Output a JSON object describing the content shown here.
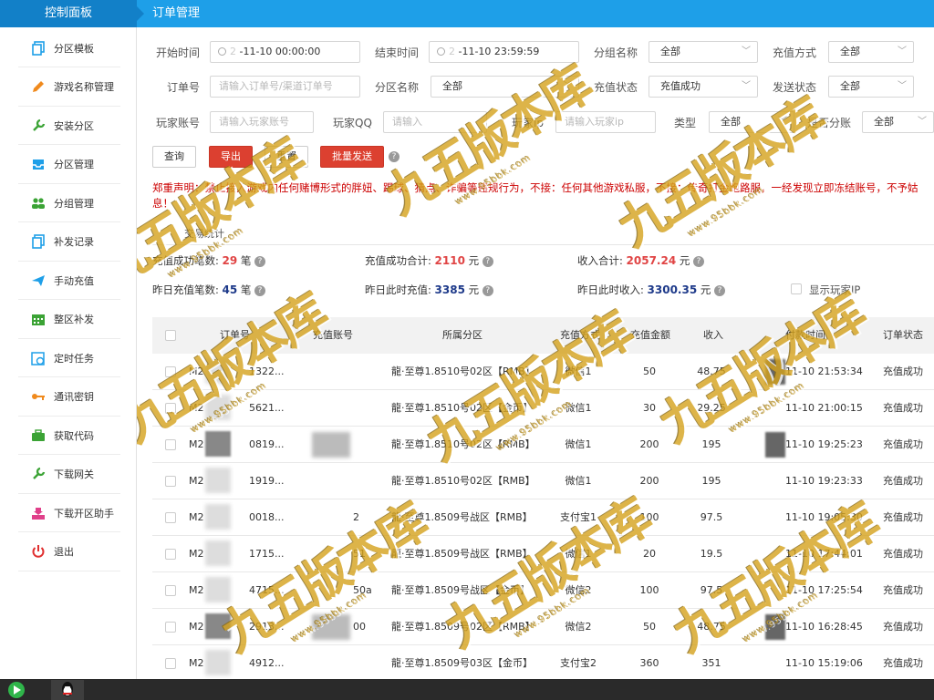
{
  "header": {
    "brand": "控制面板",
    "page_title": "订单管理"
  },
  "sidebar": {
    "items": [
      {
        "label": "分区模板",
        "icon": "copy-icon",
        "color": "#1e9fe8"
      },
      {
        "label": "游戏名称管理",
        "icon": "pencil-icon",
        "color": "#f08a1d"
      },
      {
        "label": "安装分区",
        "icon": "wrench-icon",
        "color": "#3ba335"
      },
      {
        "label": "分区管理",
        "icon": "inbox-icon",
        "color": "#1e9fe8"
      },
      {
        "label": "分组管理",
        "icon": "users-icon",
        "color": "#3ba335"
      },
      {
        "label": "补发记录",
        "icon": "copy-icon",
        "color": "#1e9fe8"
      },
      {
        "label": "手动充值",
        "icon": "send-icon",
        "color": "#1e9fe8"
      },
      {
        "label": "整区补发",
        "icon": "calendar-icon",
        "color": "#3ba335"
      },
      {
        "label": "定时任务",
        "icon": "calendar-clock-icon",
        "color": "#1e9fe8"
      },
      {
        "label": "通讯密钥",
        "icon": "key-icon",
        "color": "#f08a1d"
      },
      {
        "label": "获取代码",
        "icon": "briefcase-icon",
        "color": "#3ba335"
      },
      {
        "label": "下载网关",
        "icon": "wrench-icon",
        "color": "#3ba335"
      },
      {
        "label": "下载开区助手",
        "icon": "download-icon",
        "color": "#e0408a"
      },
      {
        "label": "退出",
        "icon": "power-icon",
        "color": "#e03030"
      }
    ]
  },
  "filters": {
    "start_time_label": "开始时间",
    "start_time_value": "-11-10 00:00:00",
    "end_time_label": "结束时间",
    "end_time_value": "-11-10 23:59:59",
    "group_label": "分组名称",
    "group_value": "全部",
    "pay_method_label": "充值方式",
    "pay_method_value": "全部",
    "order_no_label": "订单号",
    "order_no_placeholder": "请输入订单号/渠道订单号",
    "zone_label": "分区名称",
    "zone_value": "全部",
    "pay_status_label": "充值状态",
    "pay_status_value": "充值成功",
    "send_status_label": "发送状态",
    "send_status_value": "全部",
    "player_account_label": "玩家账号",
    "player_account_placeholder": "请输入玩家账号",
    "player_qq_label": "玩家QQ",
    "player_qq_placeholder": "请输入",
    "player_ip_label": "玩家ip",
    "player_ip_placeholder": "请输入玩家ip",
    "type_label": "类型",
    "type_value": "全部",
    "split_label": "是否分账",
    "split_value": "全部"
  },
  "actions": {
    "query": "查询",
    "export": "导出",
    "reset": "重置",
    "batch_send": "批量发送"
  },
  "notice": "郑重声明：禁止接入游戏内任何赌博形式的胖妞、踢球、猜点、诈骗等违规行为，不接：任何其他游戏私服，不接：传奇打金跑路服，一经发现立即冻结账号，不予姑息！",
  "stats": {
    "title": "交易统计",
    "success_count_label": "充值成功笔数:",
    "success_count_value": "29",
    "count_unit": "笔",
    "success_total_label": "充值成功合计:",
    "success_total_value": "2110",
    "money_unit": "元",
    "income_total_label": "收入合计:",
    "income_total_value": "2057.24",
    "yesterday_count_label": "昨日充值笔数:",
    "yesterday_count_value": "45",
    "yesterday_pay_label": "昨日此时充值:",
    "yesterday_pay_value": "3385",
    "yesterday_income_label": "昨日此时收入:",
    "yesterday_income_value": "3300.35",
    "show_ip_label": "显示玩家IP"
  },
  "table": {
    "headers": [
      "订单号",
      "充值账号",
      "所属分区",
      "充值方式",
      "充值金额",
      "收入",
      "付款时间",
      "订单状态"
    ],
    "rows": [
      {
        "order": "M2",
        "order_tail": "1322...",
        "account": "",
        "zone": "龍·至尊1.8510号02区【RMB】",
        "method": "微信1",
        "amount": "50",
        "income": "48.75",
        "time": "11-10 21:53:34",
        "status": "充值成功"
      },
      {
        "order": "M2",
        "order_tail": "5621...",
        "account": "",
        "zone": "龍·至尊1.8510号02区【金币】",
        "method": "微信1",
        "amount": "30",
        "income": "29.25",
        "time": "11-10 21:00:15",
        "status": "充值成功"
      },
      {
        "order": "M2",
        "order_tail": "0819...",
        "account": "",
        "zone": "龍·至尊1.8510号02区【RMB】",
        "method": "微信1",
        "amount": "200",
        "income": "195",
        "time": "11-10 19:25:23",
        "status": "充值成功"
      },
      {
        "order": "M2",
        "order_tail": "1919...",
        "account": "",
        "zone": "龍·至尊1.8510号02区【RMB】",
        "method": "微信1",
        "amount": "200",
        "income": "195",
        "time": "11-10 19:23:33",
        "status": "充值成功"
      },
      {
        "order": "M2",
        "order_tail": "0018...",
        "account": "2",
        "zone": "龍·至尊1.8509号战区【RMB】",
        "method": "支付宝1",
        "amount": "100",
        "income": "97.5",
        "time": "11-10 19:05:30",
        "status": "充值成功"
      },
      {
        "order": "M2",
        "order_tail": "1715...",
        "account": "51",
        "zone": "龍·至尊1.8509号战区【RMB】",
        "method": "微信1",
        "amount": "20",
        "income": "19.5",
        "time": "11-10 17:44:01",
        "status": "充值成功"
      },
      {
        "order": "M2",
        "order_tail": "4715...",
        "account": "50a",
        "zone": "龍·至尊1.8509号战区【金币】",
        "method": "微信2",
        "amount": "100",
        "income": "97.5",
        "time": "11-10 17:25:54",
        "status": "充值成功"
      },
      {
        "order": "M2",
        "order_tail": "2913...",
        "account": "00",
        "zone": "龍·至尊1.8509号02区【RMB】",
        "method": "微信2",
        "amount": "50",
        "income": "48.75",
        "time": "11-10 16:28:45",
        "status": "充值成功"
      },
      {
        "order": "M2",
        "order_tail": "4912...",
        "account": "",
        "zone": "龍·至尊1.8509号03区【金币】",
        "method": "支付宝2",
        "amount": "360",
        "income": "351",
        "time": "11-10 15:19:06",
        "status": "充值成功"
      }
    ]
  },
  "watermark": {
    "text": "九五版本库",
    "url": "www.95bbk.com"
  }
}
